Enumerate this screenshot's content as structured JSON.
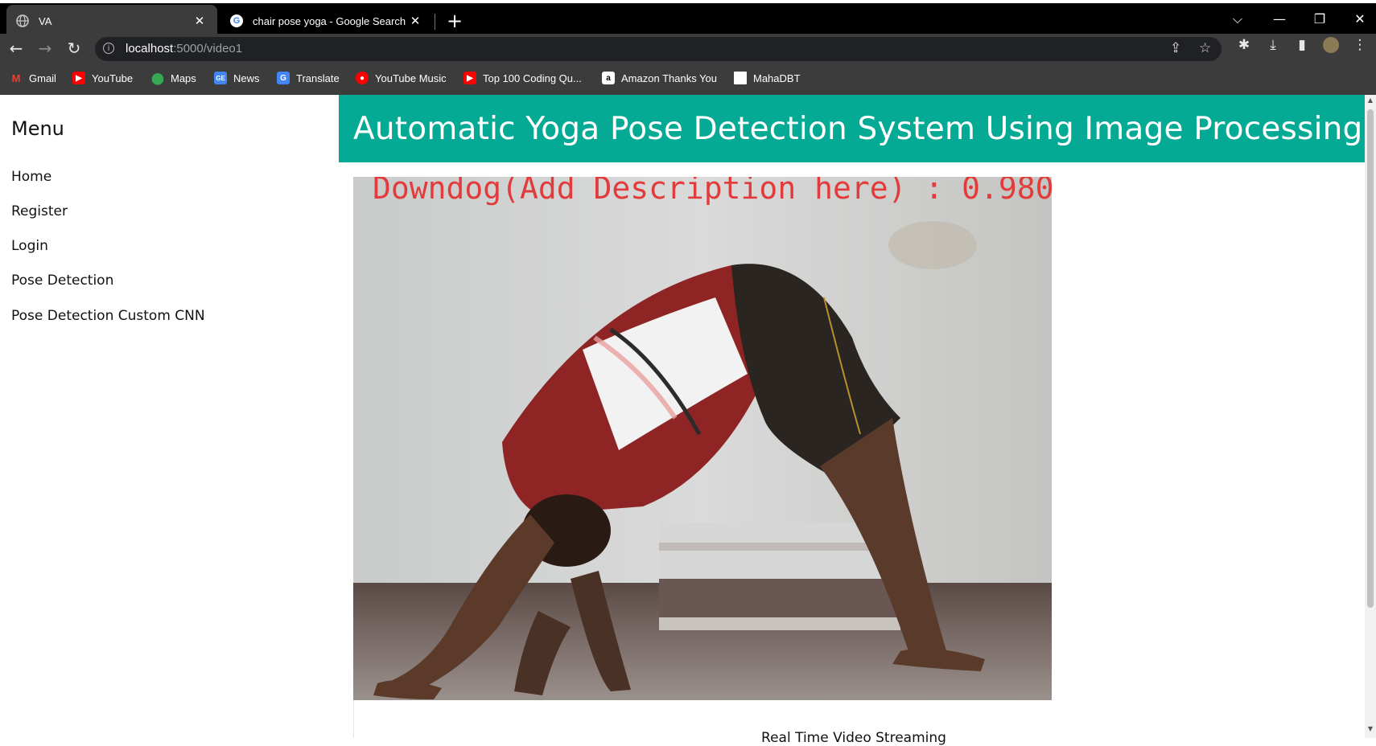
{
  "browser": {
    "tabs": [
      {
        "title": "VA",
        "icon": "globe-icon",
        "active": true
      },
      {
        "title": "chair pose yoga - Google Search",
        "icon": "google-icon",
        "active": false
      }
    ],
    "address": {
      "host": "localhost",
      "path": ":5000/video1"
    },
    "bookmarks": [
      {
        "label": "Gmail",
        "icon": "gmail-icon",
        "color": "#ea4335"
      },
      {
        "label": "YouTube",
        "icon": "youtube-icon",
        "color": "#ff0000"
      },
      {
        "label": "Maps",
        "icon": "maps-icon",
        "color": "#34a853"
      },
      {
        "label": "News",
        "icon": "news-icon",
        "color": "#4285f4"
      },
      {
        "label": "Translate",
        "icon": "translate-icon",
        "color": "#4285f4"
      },
      {
        "label": "YouTube Music",
        "icon": "youtube-music-icon",
        "color": "#ff0000"
      },
      {
        "label": "Top 100 Coding Qu...",
        "icon": "youtube-icon",
        "color": "#ff0000"
      },
      {
        "label": "Amazon Thanks You",
        "icon": "amazon-icon",
        "color": "#ffffff"
      },
      {
        "label": "MahaDBT",
        "icon": "page-icon",
        "color": "#ffffff"
      }
    ]
  },
  "sidebar": {
    "title": "Menu",
    "items": [
      {
        "label": "Home"
      },
      {
        "label": "Register"
      },
      {
        "label": "Login"
      },
      {
        "label": "Pose Detection"
      },
      {
        "label": "Pose Detection Custom CNN"
      }
    ]
  },
  "header": {
    "title": "Automatic Yoga Pose Detection System Using Image Processing",
    "color": "#04aa94"
  },
  "video": {
    "overlay_text": "Downdog(Add Description here) : 0.980",
    "overlay_color": "#e23b3b"
  },
  "caption": {
    "text": "Real Time Video Streaming"
  }
}
